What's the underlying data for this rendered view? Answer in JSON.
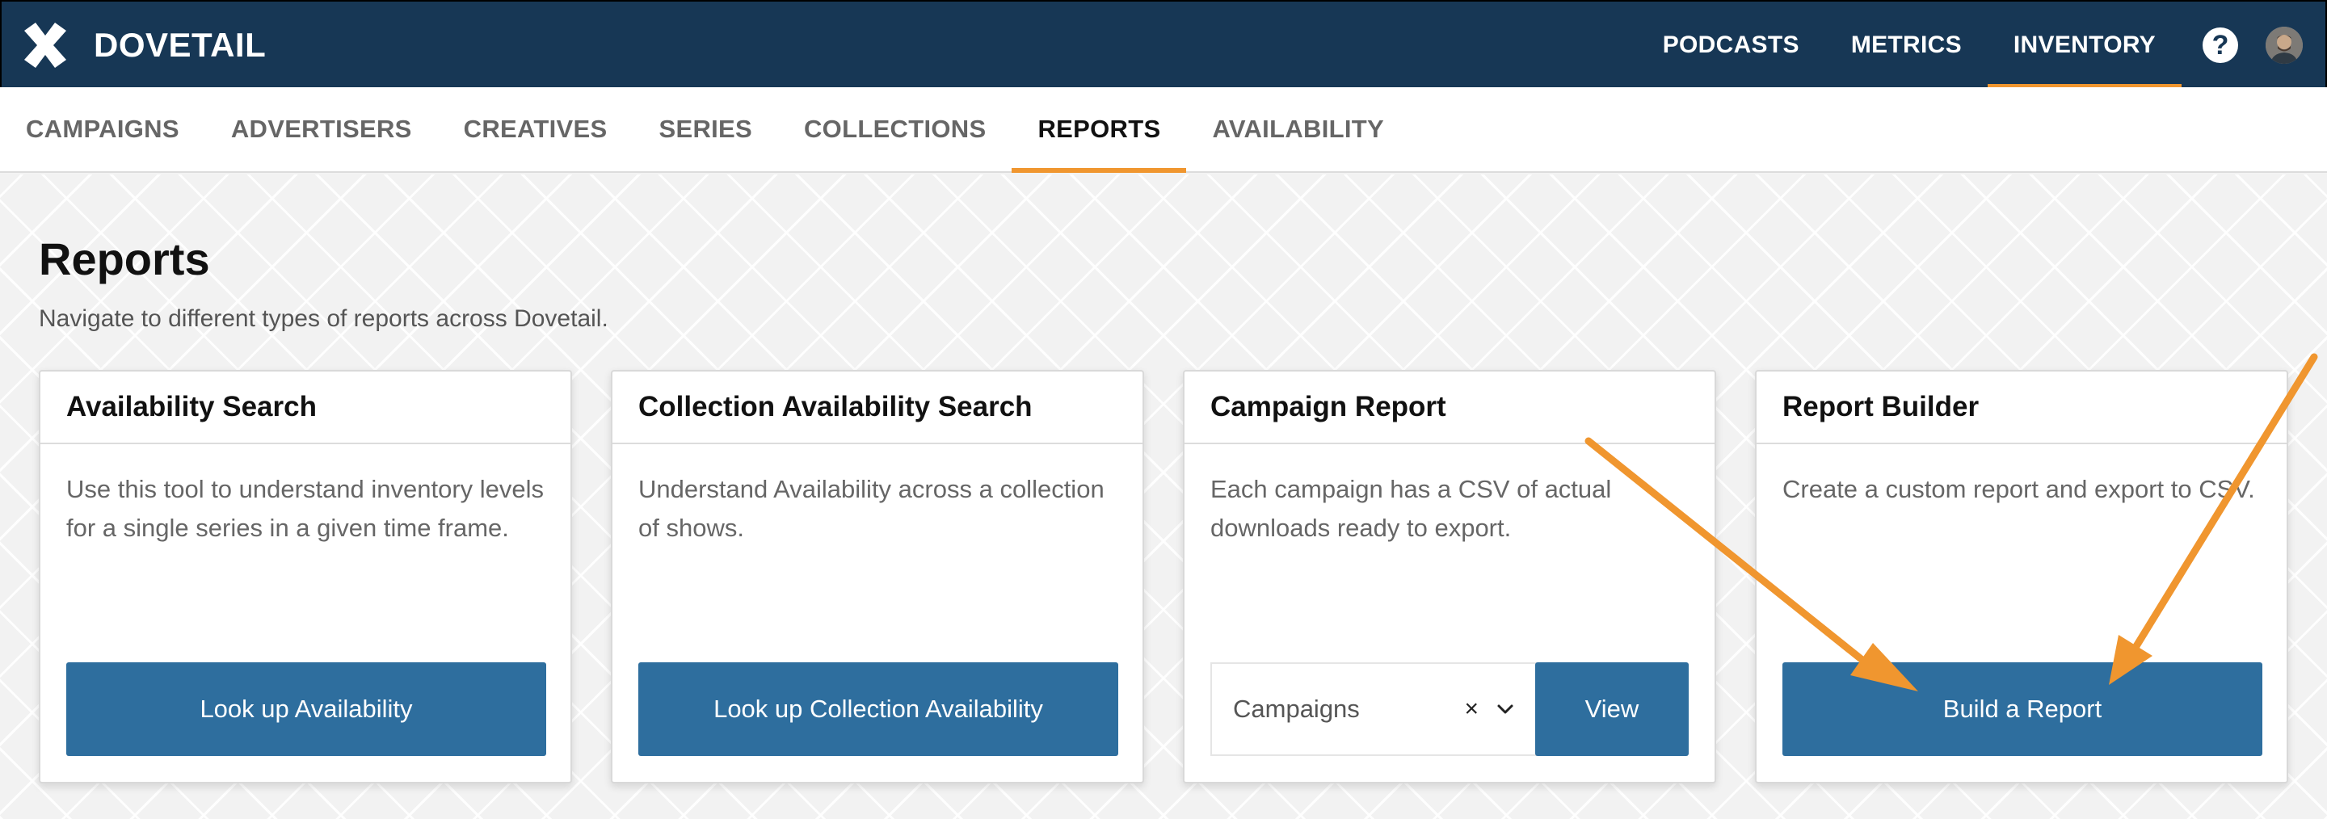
{
  "brand": {
    "name": "DOVETAIL",
    "logo_icon": "dovetail-x-logo-icon"
  },
  "topnav": {
    "items": [
      {
        "label": "PODCASTS",
        "active": false
      },
      {
        "label": "METRICS",
        "active": false
      },
      {
        "label": "INVENTORY",
        "active": true
      }
    ],
    "help_label": "?",
    "help_icon": "help-circle-icon",
    "avatar_icon": "user-avatar-icon"
  },
  "subnav": {
    "items": [
      {
        "label": "CAMPAIGNS",
        "active": false
      },
      {
        "label": "ADVERTISERS",
        "active": false
      },
      {
        "label": "CREATIVES",
        "active": false
      },
      {
        "label": "SERIES",
        "active": false
      },
      {
        "label": "COLLECTIONS",
        "active": false
      },
      {
        "label": "REPORTS",
        "active": true
      },
      {
        "label": "AVAILABILITY",
        "active": false
      }
    ]
  },
  "page": {
    "title": "Reports",
    "subtitle": "Navigate to different types of reports across Dovetail."
  },
  "cards": [
    {
      "title": "Availability Search",
      "description": "Use this tool to understand inventory levels for a single series in a given time frame.",
      "button_label": "Look up Availability"
    },
    {
      "title": "Collection Availability Search",
      "description": "Understand Availability across a collection of shows.",
      "button_label": "Look up Collection Availability"
    },
    {
      "title": "Campaign Report",
      "description": "Each campaign has a CSV of actual downloads ready to export.",
      "select_value": "Campaigns",
      "clear_symbol": "×",
      "button_label": "View"
    },
    {
      "title": "Report Builder",
      "description": "Create a custom report and export to CSV.",
      "button_label": "Build a Report"
    }
  ],
  "colors": {
    "topbar": "#173755",
    "accent": "#f0962f",
    "button": "#2e6e9e",
    "annotation_arrow": "#f0962f"
  }
}
